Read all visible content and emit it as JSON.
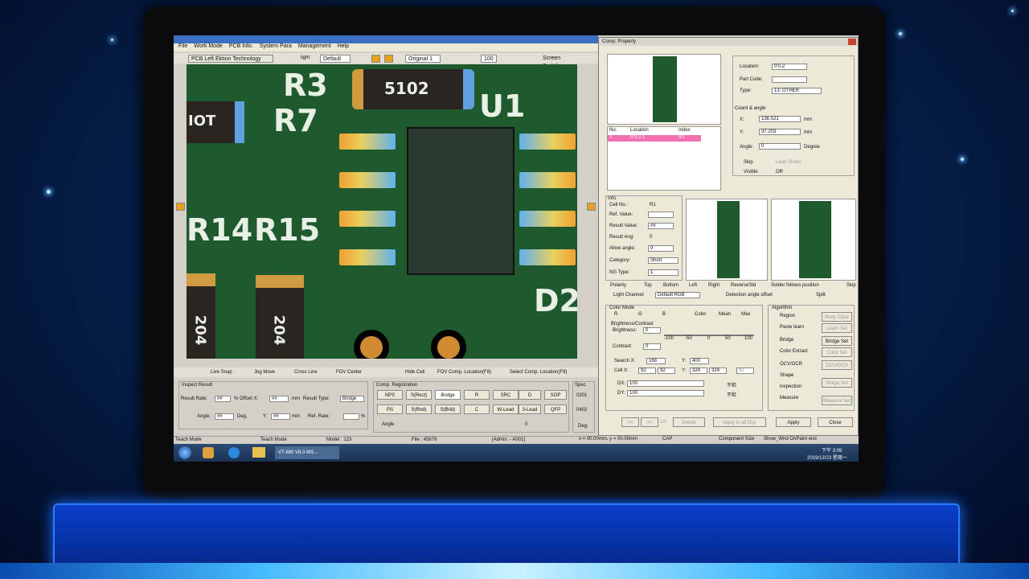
{
  "main_window": {
    "menu": [
      "File",
      "Work Mode",
      "PCB Info.",
      "System Para",
      "Management",
      "Help"
    ],
    "toolbar": {
      "pcb_label": "PCB Left  Ektion Technology",
      "light_label": "light:",
      "light_value": "Default",
      "view_value": "Original 1",
      "zoom_value": "100",
      "screen_switch": "Screen Switch"
    },
    "pcb_labels": {
      "r3": "R3",
      "r7": "R7",
      "r14": "R14",
      "r15": "R15",
      "u1": "U1",
      "d2": "D2",
      "res_a": "5102",
      "res_b": "204",
      "res_c": "204",
      "res_d": "IOT"
    },
    "bottom_bar": {
      "live_snap": "Live Snap",
      "jog_move": "Jog Move",
      "cross_line": "Cross Line",
      "fov_center": "FOV Center",
      "hide_cell": "Hide Cell",
      "fov_comp_loc": "FOV Comp. Location(F8)",
      "select_comp_loc": "Select Comp. Location(F9)"
    },
    "inspect_result": {
      "title": "Inspect Result",
      "result_rate": "Result Rate:",
      "result_rate_val": "##",
      "offset_x": "% Offset X:",
      "offset_x_val": "##",
      "mm": "mm",
      "result_type": "Result Type:",
      "result_type_val": "Bridge",
      "angle": "Angle:",
      "angle_val": "##",
      "deg": "Deg.",
      "y": "Y:",
      "y_val": "##",
      "ref_rate": "Ref. Rate:",
      "pct": "%"
    },
    "comp_registration": {
      "title": "Comp. Registration",
      "buttons": [
        "NPS",
        "S(Rect)",
        "Bridge",
        "R",
        "SRC",
        "D",
        "SOP",
        "PS",
        "S(Rnd)",
        "S(Brid)",
        "C",
        "W-Lead",
        "3-Lead",
        "QFP"
      ],
      "spec": "Spec",
      "spec_vals": [
        "0201",
        "0402"
      ],
      "angle": "Angle",
      "angle_val": "0",
      "deg": "Deg."
    },
    "status": {
      "mode": "Teach Mode",
      "mode2": "Teach Mode",
      "model": "Model : 123",
      "file": "File : 45679",
      "admin": "[Admin. - A001]",
      "coords": "x = 00.00mm, y = 00.00mm",
      "cap": "CAP",
      "comp_size": "Component Size",
      "show_wnd": "Show_Wnd  OnPaint end"
    }
  },
  "comp_property": {
    "title": "Comp. Property",
    "location_label": "Location:",
    "location_val": "0'0-2",
    "part_code_label": "Part Code:",
    "type_label": "Type:",
    "type_val": "13: OTHER",
    "coord_title": "Coord & angle",
    "x_label": "X:",
    "x_val": "136.521",
    "y_label": "Y:",
    "y_val": "37.203",
    "mm": "mm",
    "angle_label": "Angle:",
    "angle_val": "0",
    "degree": "Degree",
    "skip": "Skip",
    "lead_share": "Lead Share",
    "visible": "Visible",
    "or": "OR",
    "table_headers": [
      "No.",
      "Location",
      "Index"
    ],
    "table_row": [
      "1",
      "0'0-2-1",
      "R1"
    ],
    "info_title": "Info.",
    "cell_no": "Cell No.:",
    "cell_no_val": "R1",
    "ref_value": "Ref. Value:",
    "result_value": "Result Value:",
    "result_value_val": "##",
    "result_ang": "Result Ang:",
    "result_ang_val": "0",
    "allow_angle": "Allow angle:",
    "allow_angle_val": "0",
    "category": "Category:",
    "category_val": "Short",
    "ng_type": "NG Type:",
    "ng_type_val": "1",
    "polarity": "Polarity",
    "top": "Top",
    "bottom": "Bottom",
    "left": "Left",
    "right": "Right",
    "reverse_std": "ReverseStd",
    "solder_follows": "Solder follows position",
    "skip2": "Skip",
    "light_channel": "Light Channel:",
    "light_channel_val": "Default RGB",
    "detection_offset": "Detection angle offset",
    "split": "Split",
    "color_mode": "Color Mode",
    "r": "R",
    "g": "G",
    "b": "B",
    "color": "Color",
    "mean": "Mean",
    "max": "Max",
    "brightness_contrast": "Brightness/Contrast",
    "brightness": "Brightness:",
    "brightness_val": "0",
    "contrast": "Contrast:",
    "contrast_val": "0",
    "scale": [
      "-100",
      "-50",
      "0",
      "50",
      "100"
    ],
    "search_x": "Search X:",
    "search_x_val": "168",
    "search_y": "Y:",
    "search_y_val": "400",
    "cell_x": "Cell X:",
    "cell_x_vals": [
      "92",
      "92"
    ],
    "cell_y": "Y:",
    "cell_y_vals": [
      "324",
      "324"
    ],
    "cell_extra": "92",
    "dx": "DX:",
    "dx_val": "100",
    "dy": "DY:",
    "dy_val": "100",
    "unit1": "不检",
    "unit2": "不检",
    "algorithm_title": "Algorithm",
    "algorithms": [
      "Region",
      "Paste learn",
      "Bridge",
      "Color Extract",
      "OCV/OCR",
      "Shape",
      "inspection",
      "Measure"
    ],
    "algo_buttons": [
      "Body Color",
      "Learn Set",
      "Bridge Set",
      "Color Set",
      "OCV/OCR",
      "Shape Set",
      "Measure Set"
    ],
    "nav": [
      "<<",
      ">>",
      "1/1",
      "Delete",
      "Apply to all Grp.",
      "Apply",
      "Close"
    ]
  },
  "taskbar": {
    "app": "VT-880 V8.0-MS...",
    "time": "下午 3:09",
    "date": "2019/12/23 星期一"
  }
}
